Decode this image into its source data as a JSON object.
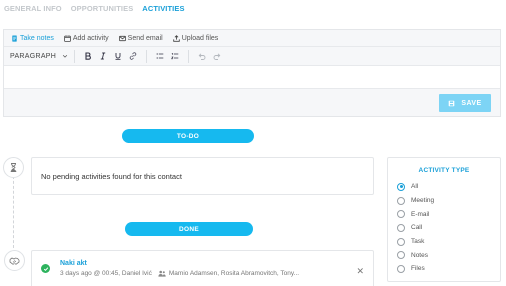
{
  "tabs": [
    {
      "label": "GENERAL INFO",
      "active": false
    },
    {
      "label": "OPPORTUNITIES",
      "active": false
    },
    {
      "label": "ACTIVITIES",
      "active": true
    }
  ],
  "editor": {
    "actions": [
      {
        "label": "Take notes",
        "icon": "notes-icon",
        "active": true
      },
      {
        "label": "Add activity",
        "icon": "calendar-icon",
        "active": false
      },
      {
        "label": "Send email",
        "icon": "envelope-icon",
        "active": false
      },
      {
        "label": "Upload files",
        "icon": "upload-icon",
        "active": false
      }
    ],
    "format_select": "PARAGRAPH",
    "save_label": "SAVE"
  },
  "todo": {
    "label": "TO-DO",
    "empty_message": "No pending activities found for this contact"
  },
  "done": {
    "label": "DONE",
    "activity": {
      "title": "Naki akt",
      "meta": "3 days ago @ 00:45, Daniel Ivić",
      "participants": "Mamio Adamsen, Rosita Abramovitch, Tony..."
    }
  },
  "filter": {
    "title": "ACTIVITY TYPE",
    "selected": "All",
    "options": [
      "All",
      "Meeting",
      "E-mail",
      "Call",
      "Task",
      "Notes",
      "Files"
    ]
  },
  "colors": {
    "accent": "#1aa0d8",
    "pill": "#16b9ef",
    "save": "#7dd4f5",
    "success": "#2db35e"
  }
}
